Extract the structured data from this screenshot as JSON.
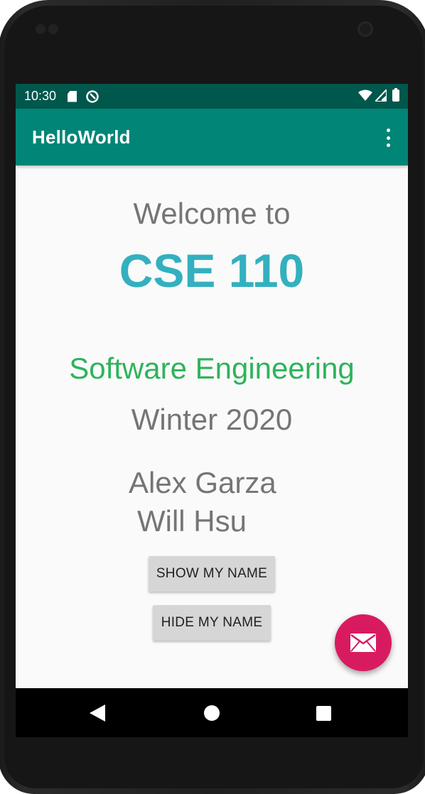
{
  "status_bar": {
    "time": "10:30",
    "icons": [
      "sd-card-icon",
      "sync-icon",
      "wifi-icon",
      "signal-icon",
      "battery-icon"
    ]
  },
  "app_bar": {
    "title": "HelloWorld",
    "menu_icon": "overflow-menu-icon"
  },
  "content": {
    "welcome": "Welcome to",
    "course": "CSE 110",
    "subject": "Software Engineering",
    "term": "Winter 2020",
    "names": [
      "Alex Garza",
      "Will Hsu"
    ]
  },
  "buttons": {
    "show_label": "SHOW MY NAME",
    "hide_label": "HIDE MY NAME"
  },
  "fab": {
    "icon": "email-icon"
  },
  "nav_bar": {
    "icons": [
      "back-icon",
      "home-icon",
      "recents-icon"
    ]
  },
  "colors": {
    "status_bar": "#00574b",
    "app_bar": "#008577",
    "course_text": "#33b0bf",
    "subject_text": "#2eb35b",
    "fab": "#d81b60",
    "body_text": "#757575"
  }
}
